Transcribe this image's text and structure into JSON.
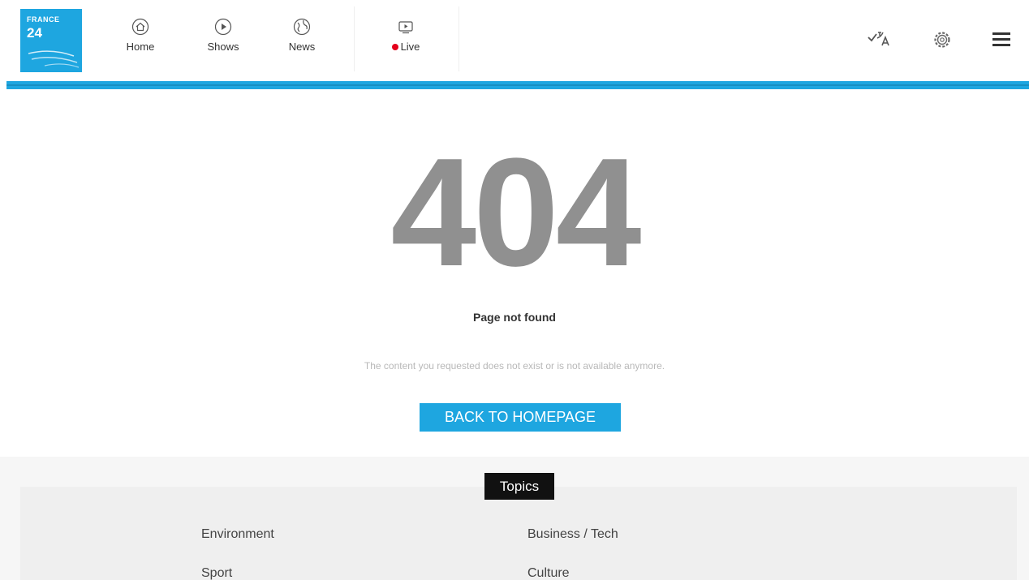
{
  "header": {
    "logo": {
      "line1": "FRANCE",
      "line2": "24",
      "color": "#1ea6e0"
    },
    "nav": [
      {
        "label": "Home",
        "icon": "home-icon"
      },
      {
        "label": "Shows",
        "icon": "play-circle-icon"
      },
      {
        "label": "News",
        "icon": "globe-icon"
      },
      {
        "label": "Live",
        "icon": "tv-icon",
        "live_dot_color": "#e4001b"
      }
    ],
    "actions": [
      {
        "icon": "language-icon"
      },
      {
        "icon": "gear-icon"
      },
      {
        "icon": "hamburger-menu-icon"
      }
    ],
    "accent_bar_color": "#1ea6e0"
  },
  "error": {
    "code": "404",
    "title": "Page not found",
    "message": "The content you requested does not exist or is not available anymore.",
    "button_label": "BACK TO HOMEPAGE",
    "button_color": "#1ea6e0"
  },
  "topics": {
    "heading": "Topics",
    "items": [
      "Environment",
      "Business / Tech",
      "Sport",
      "Culture"
    ]
  }
}
